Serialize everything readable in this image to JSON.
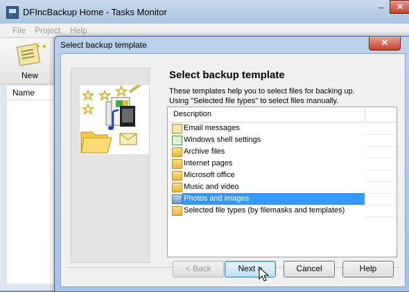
{
  "main_window": {
    "title": "DFIncBackup Home - Tasks Monitor",
    "menu": [
      "File",
      "Project",
      "Help"
    ],
    "toolbar_new_label": "New",
    "list_column": "Name"
  },
  "dialog": {
    "title": "Select backup template",
    "heading": "Select backup template",
    "description_line1": "These templates help you to select files for backing up.",
    "description_line2": "Using \"Selected file types\" to select files manually.",
    "column_header": "Description",
    "items": [
      {
        "label": "Email messages",
        "icon": "email-icon"
      },
      {
        "label": "Windows shell settings",
        "icon": "settings-icon"
      },
      {
        "label": "Archive files",
        "icon": "folder-icon"
      },
      {
        "label": "Internet pages",
        "icon": "folder-icon"
      },
      {
        "label": "Microsoft office",
        "icon": "folder-icon"
      },
      {
        "label": "Music and video",
        "icon": "folder-icon"
      },
      {
        "label": "Photos and images",
        "icon": "folder-icon",
        "selected": true
      },
      {
        "label": "Selected file types (by filemasks and templates)",
        "icon": "folder-icon"
      }
    ],
    "buttons": {
      "back": "< Back",
      "next": "Next >",
      "cancel": "Cancel",
      "help": "Help"
    }
  }
}
